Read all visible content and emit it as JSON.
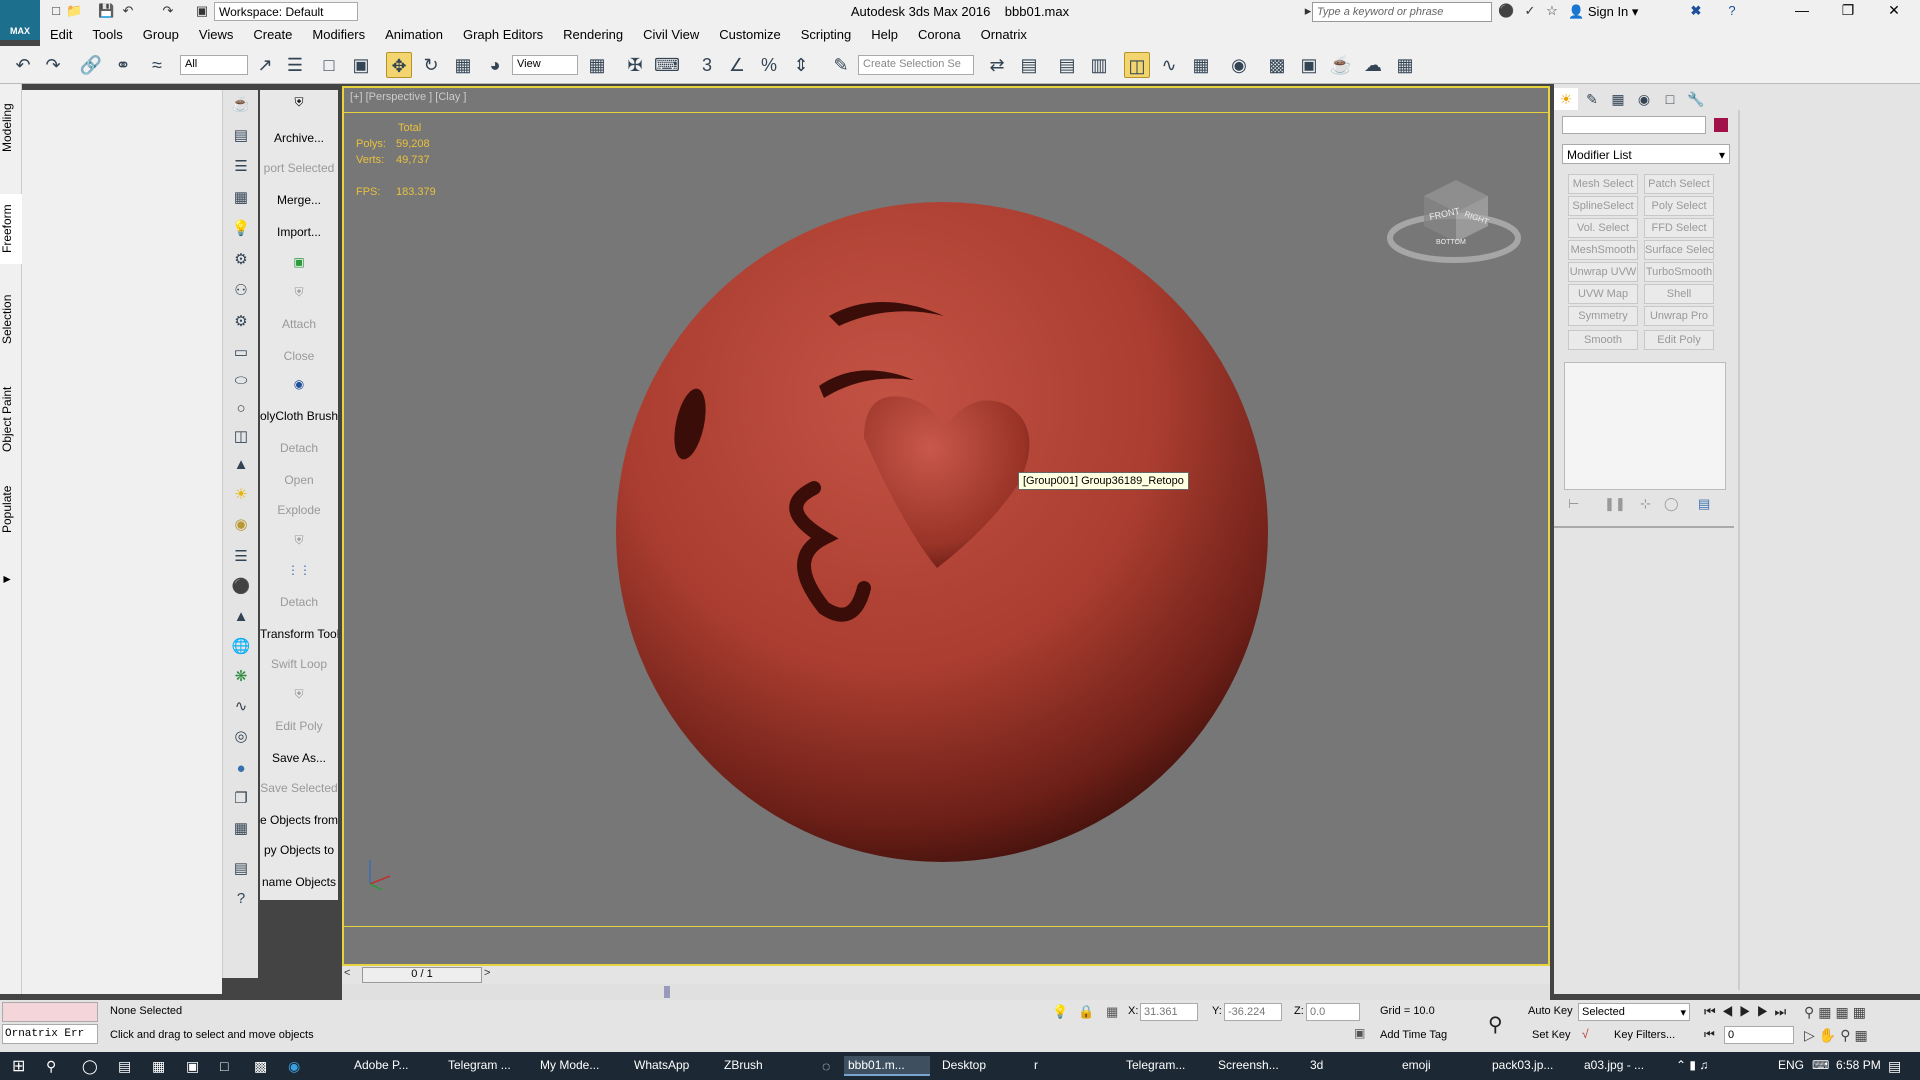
{
  "titlebar": {
    "app_title": "Autodesk 3ds Max 2016",
    "file_name": "bbb01.max",
    "workspace": "Workspace: Default",
    "search_placeholder": "Type a keyword or phrase",
    "sign_in": "Sign In",
    "logo_text": "MAX"
  },
  "menu": [
    "Edit",
    "Tools",
    "Group",
    "Views",
    "Create",
    "Modifiers",
    "Animation",
    "Graph Editors",
    "Rendering",
    "Civil View",
    "Customize",
    "Scripting",
    "Help",
    "Corona",
    "Ornatrix"
  ],
  "toolbar": {
    "filter_value": "All",
    "view_value": "View",
    "selection_set_placeholder": "Create Selection Se"
  },
  "ribbon_tabs": [
    "Modeling",
    "Freeform",
    "Selection",
    "Object Paint",
    "Populate"
  ],
  "script_buttons": [
    {
      "label": "Archive...",
      "dim": false
    },
    {
      "label": "port Selected",
      "dim": true
    },
    {
      "label": "Merge...",
      "dim": false
    },
    {
      "label": "Import...",
      "dim": false
    },
    {
      "label": "Attach",
      "dim": true
    },
    {
      "label": "Close",
      "dim": true
    },
    {
      "label": "olyCloth Brush",
      "dim": false
    },
    {
      "label": "Detach",
      "dim": true
    },
    {
      "label": "Open",
      "dim": true
    },
    {
      "label": "Explode",
      "dim": true
    },
    {
      "label": "Detach",
      "dim": true
    },
    {
      "label": "Transform Tool",
      "dim": false
    },
    {
      "label": "Swift Loop",
      "dim": true
    },
    {
      "label": "Edit Poly",
      "dim": true
    },
    {
      "label": "Save As...",
      "dim": false
    },
    {
      "label": "Save Selected",
      "dim": true
    },
    {
      "label": "e Objects from",
      "dim": false
    },
    {
      "label": "py Objects to",
      "dim": false
    },
    {
      "label": "name Objects",
      "dim": false
    }
  ],
  "viewport": {
    "label": "[+] [Perspective ] [Clay ]",
    "stats_header": "Total",
    "polys_label": "Polys:",
    "polys_value": "59,208",
    "verts_label": "Verts:",
    "verts_value": "49,737",
    "fps_label": "FPS:",
    "fps_value": "183.379",
    "tooltip": "[Group001] Group36189_Retopo",
    "viewcube_front": "FRONT",
    "viewcube_right": "RIGHT",
    "viewcube_bottom": "BOTTOM"
  },
  "time_slider": "0 / 1",
  "command_panel": {
    "modifier_list": "Modifier List",
    "swatch_color": "#a1124a",
    "modifier_buttons": [
      [
        "Mesh Select",
        "Patch Select"
      ],
      [
        "SplineSelect",
        "Poly Select"
      ],
      [
        "Vol. Select",
        "FFD Select"
      ],
      [
        "MeshSmooth",
        "Surface Select"
      ],
      [
        "Unwrap UVW",
        "TurboSmooth"
      ],
      [
        "UVW Map",
        "Shell"
      ],
      [
        "Symmetry",
        "Unwrap Pro"
      ],
      [
        "Smooth",
        "Edit Poly"
      ]
    ]
  },
  "status": {
    "script_listener": "Ornatrix Err",
    "selection": "None Selected",
    "prompt": "Click and drag to select and move objects",
    "x_label": "X:",
    "x_value": "31.361",
    "y_label": "Y:",
    "y_value": "-36.224",
    "z_label": "Z:",
    "z_value": "0.0",
    "grid": "Grid = 10.0",
    "add_time_tag": "Add Time Tag",
    "auto_key": "Auto Key",
    "set_key": "Set Key",
    "selected_dropdown": "Selected",
    "key_filters": "Key Filters...",
    "frame": "0"
  },
  "taskbar": {
    "items": [
      "Adobe P...",
      "Telegram ...",
      "My Mode...",
      "WhatsApp",
      "ZBrush",
      "bbb01.m...",
      "Desktop",
      "r",
      "Telegram...",
      "Screensh...",
      "3d",
      "emoji",
      "pack03.jp...",
      "a03.jpg - ..."
    ],
    "lang": "ENG",
    "clock": "6:58 PM"
  },
  "colors": {
    "viewport_border": "#e6d33d",
    "stats_text": "#e8c13c",
    "model_base": "#b84a3c"
  }
}
